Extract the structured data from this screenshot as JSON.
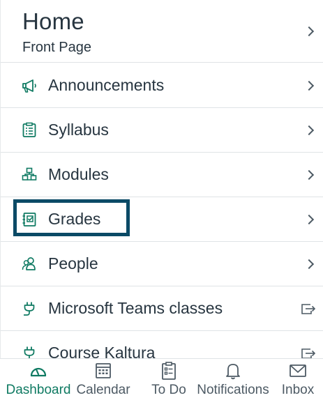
{
  "home": {
    "title": "Home",
    "subtitle": "Front Page"
  },
  "menu": [
    {
      "label": "Announcements",
      "icon": "megaphone-icon",
      "trailing": "chevron"
    },
    {
      "label": "Syllabus",
      "icon": "syllabus-icon",
      "trailing": "chevron"
    },
    {
      "label": "Modules",
      "icon": "modules-icon",
      "trailing": "chevron"
    },
    {
      "label": "Grades",
      "icon": "gradebook-icon",
      "trailing": "chevron"
    },
    {
      "label": "People",
      "icon": "people-icon",
      "trailing": "chevron"
    },
    {
      "label": "Microsoft Teams classes",
      "icon": "plug-icon",
      "trailing": "external"
    },
    {
      "label": "Course Kaltura",
      "icon": "plug-icon",
      "trailing": "external"
    }
  ],
  "tabs": [
    {
      "label": "Dashboard",
      "icon": "dashboard-gauge-icon",
      "active": true
    },
    {
      "label": "Calendar",
      "icon": "calendar-icon",
      "active": false
    },
    {
      "label": "To Do",
      "icon": "todo-clipboard-icon",
      "active": false
    },
    {
      "label": "Notifications",
      "icon": "bell-icon",
      "active": false
    },
    {
      "label": "Inbox",
      "icon": "envelope-icon",
      "active": false
    }
  ],
  "colors": {
    "accent": "#0f7a62",
    "highlight_border": "#0b4a66",
    "text": "#273540",
    "divider": "#dfe3e6"
  }
}
